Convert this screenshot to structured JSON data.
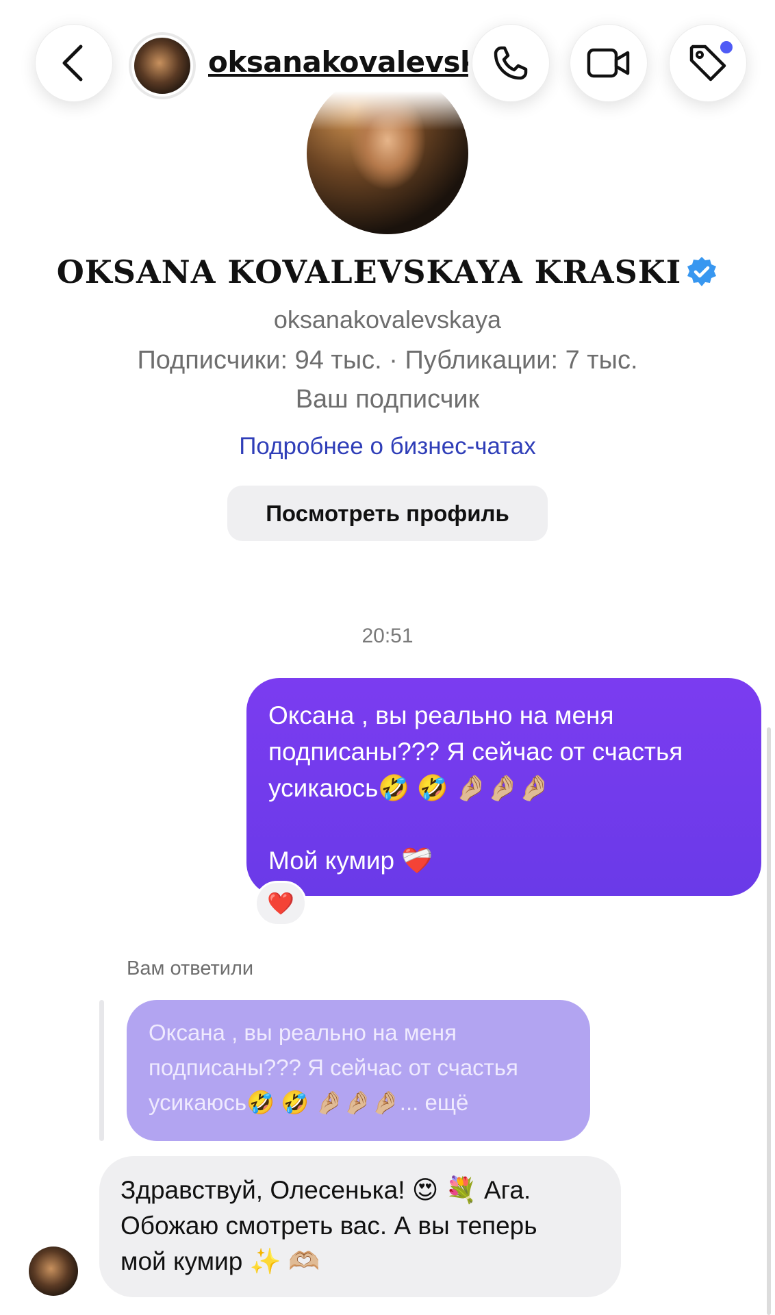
{
  "header": {
    "username": "oksanakovalevsk...",
    "back_icon": "chevron-left-icon",
    "call_icon": "phone-icon",
    "video_icon": "video-camera-icon",
    "label_icon": "tag-icon",
    "dot_color": "#4f5bf5"
  },
  "profile": {
    "display_name": "OKSANA KOVALEVSKAYA KRASKI",
    "verified_icon": "verified-badge-icon",
    "handle": "oksanakovalevskaya",
    "stats": "Подписчики: 94 тыс. · Публикации: 7 тыс.",
    "follow_status": "Ваш подписчик",
    "business_link": "Подробнее о бизнес-чатах",
    "view_profile_label": "Посмотреть профиль"
  },
  "chat": {
    "timestamp": "20:51",
    "outgoing": {
      "line1": "Оксана , вы реально на меня",
      "line2": "подписаны??? Я сейчас от счастья",
      "line3": "усикаюсь🤣 🤣 🤌🏼🤌🏼🤌🏼",
      "line4": "Мой кумир ❤️‍🩹",
      "reaction": "❤️",
      "color": "#6f3bec"
    },
    "reply_label": "Вам ответили",
    "quoted": {
      "line1": "Оксана , вы реально на меня",
      "line2": "подписаны??? Я сейчас от счастья",
      "line3": "усикаюсь🤣 🤣 🤌🏼🤌🏼🤌🏼... ещё"
    },
    "incoming": {
      "line1": "Здравствуй, Олесенька! 😍 💐  Ага.",
      "line2": "Обожаю смотреть вас. А вы теперь",
      "line3": "мой кумир ✨ 🫶🏼"
    }
  }
}
